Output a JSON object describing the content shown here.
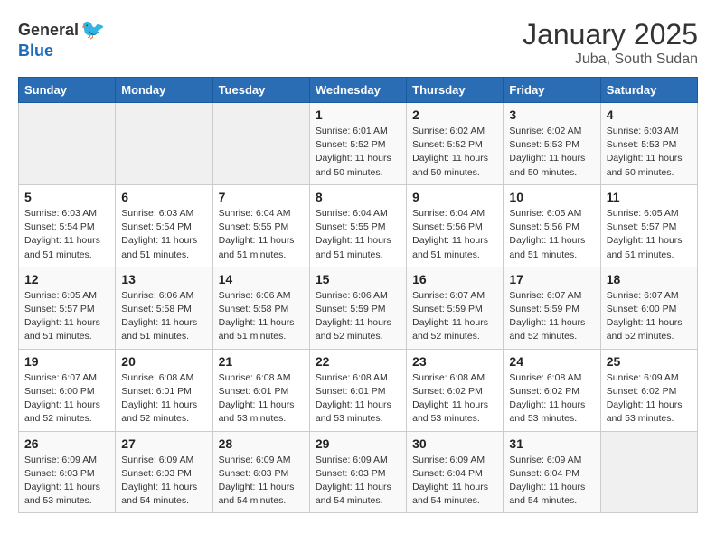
{
  "header": {
    "logo_general": "General",
    "logo_blue": "Blue",
    "month_title": "January 2025",
    "subtitle": "Juba, South Sudan"
  },
  "days_of_week": [
    "Sunday",
    "Monday",
    "Tuesday",
    "Wednesday",
    "Thursday",
    "Friday",
    "Saturday"
  ],
  "weeks": [
    [
      {
        "day": "",
        "info": ""
      },
      {
        "day": "",
        "info": ""
      },
      {
        "day": "",
        "info": ""
      },
      {
        "day": "1",
        "info": "Sunrise: 6:01 AM\nSunset: 5:52 PM\nDaylight: 11 hours\nand 50 minutes."
      },
      {
        "day": "2",
        "info": "Sunrise: 6:02 AM\nSunset: 5:52 PM\nDaylight: 11 hours\nand 50 minutes."
      },
      {
        "day": "3",
        "info": "Sunrise: 6:02 AM\nSunset: 5:53 PM\nDaylight: 11 hours\nand 50 minutes."
      },
      {
        "day": "4",
        "info": "Sunrise: 6:03 AM\nSunset: 5:53 PM\nDaylight: 11 hours\nand 50 minutes."
      }
    ],
    [
      {
        "day": "5",
        "info": "Sunrise: 6:03 AM\nSunset: 5:54 PM\nDaylight: 11 hours\nand 51 minutes."
      },
      {
        "day": "6",
        "info": "Sunrise: 6:03 AM\nSunset: 5:54 PM\nDaylight: 11 hours\nand 51 minutes."
      },
      {
        "day": "7",
        "info": "Sunrise: 6:04 AM\nSunset: 5:55 PM\nDaylight: 11 hours\nand 51 minutes."
      },
      {
        "day": "8",
        "info": "Sunrise: 6:04 AM\nSunset: 5:55 PM\nDaylight: 11 hours\nand 51 minutes."
      },
      {
        "day": "9",
        "info": "Sunrise: 6:04 AM\nSunset: 5:56 PM\nDaylight: 11 hours\nand 51 minutes."
      },
      {
        "day": "10",
        "info": "Sunrise: 6:05 AM\nSunset: 5:56 PM\nDaylight: 11 hours\nand 51 minutes."
      },
      {
        "day": "11",
        "info": "Sunrise: 6:05 AM\nSunset: 5:57 PM\nDaylight: 11 hours\nand 51 minutes."
      }
    ],
    [
      {
        "day": "12",
        "info": "Sunrise: 6:05 AM\nSunset: 5:57 PM\nDaylight: 11 hours\nand 51 minutes."
      },
      {
        "day": "13",
        "info": "Sunrise: 6:06 AM\nSunset: 5:58 PM\nDaylight: 11 hours\nand 51 minutes."
      },
      {
        "day": "14",
        "info": "Sunrise: 6:06 AM\nSunset: 5:58 PM\nDaylight: 11 hours\nand 51 minutes."
      },
      {
        "day": "15",
        "info": "Sunrise: 6:06 AM\nSunset: 5:59 PM\nDaylight: 11 hours\nand 52 minutes."
      },
      {
        "day": "16",
        "info": "Sunrise: 6:07 AM\nSunset: 5:59 PM\nDaylight: 11 hours\nand 52 minutes."
      },
      {
        "day": "17",
        "info": "Sunrise: 6:07 AM\nSunset: 5:59 PM\nDaylight: 11 hours\nand 52 minutes."
      },
      {
        "day": "18",
        "info": "Sunrise: 6:07 AM\nSunset: 6:00 PM\nDaylight: 11 hours\nand 52 minutes."
      }
    ],
    [
      {
        "day": "19",
        "info": "Sunrise: 6:07 AM\nSunset: 6:00 PM\nDaylight: 11 hours\nand 52 minutes."
      },
      {
        "day": "20",
        "info": "Sunrise: 6:08 AM\nSunset: 6:01 PM\nDaylight: 11 hours\nand 52 minutes."
      },
      {
        "day": "21",
        "info": "Sunrise: 6:08 AM\nSunset: 6:01 PM\nDaylight: 11 hours\nand 53 minutes."
      },
      {
        "day": "22",
        "info": "Sunrise: 6:08 AM\nSunset: 6:01 PM\nDaylight: 11 hours\nand 53 minutes."
      },
      {
        "day": "23",
        "info": "Sunrise: 6:08 AM\nSunset: 6:02 PM\nDaylight: 11 hours\nand 53 minutes."
      },
      {
        "day": "24",
        "info": "Sunrise: 6:08 AM\nSunset: 6:02 PM\nDaylight: 11 hours\nand 53 minutes."
      },
      {
        "day": "25",
        "info": "Sunrise: 6:09 AM\nSunset: 6:02 PM\nDaylight: 11 hours\nand 53 minutes."
      }
    ],
    [
      {
        "day": "26",
        "info": "Sunrise: 6:09 AM\nSunset: 6:03 PM\nDaylight: 11 hours\nand 53 minutes."
      },
      {
        "day": "27",
        "info": "Sunrise: 6:09 AM\nSunset: 6:03 PM\nDaylight: 11 hours\nand 54 minutes."
      },
      {
        "day": "28",
        "info": "Sunrise: 6:09 AM\nSunset: 6:03 PM\nDaylight: 11 hours\nand 54 minutes."
      },
      {
        "day": "29",
        "info": "Sunrise: 6:09 AM\nSunset: 6:03 PM\nDaylight: 11 hours\nand 54 minutes."
      },
      {
        "day": "30",
        "info": "Sunrise: 6:09 AM\nSunset: 6:04 PM\nDaylight: 11 hours\nand 54 minutes."
      },
      {
        "day": "31",
        "info": "Sunrise: 6:09 AM\nSunset: 6:04 PM\nDaylight: 11 hours\nand 54 minutes."
      },
      {
        "day": "",
        "info": ""
      }
    ]
  ]
}
